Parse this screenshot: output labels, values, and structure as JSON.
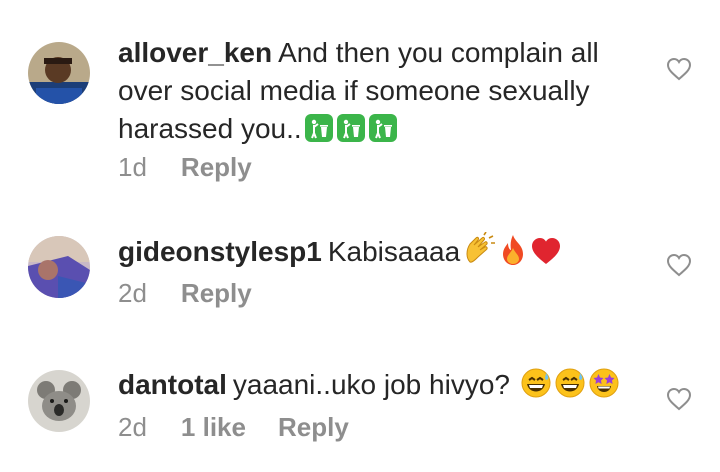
{
  "comments": [
    {
      "username": "allover_ken",
      "text": "And then you complain all over social media if someone sexually harassed you..",
      "emoji": [
        "litter-bin-icon",
        "litter-bin-icon",
        "litter-bin-icon"
      ],
      "time": "1d",
      "likes": "",
      "reply_label": "Reply"
    },
    {
      "username": "gideonstylesp1",
      "text": "Kabisaaaa",
      "emoji": [
        "clapping-hands-icon",
        "fire-icon",
        "red-heart-icon"
      ],
      "time": "2d",
      "likes": "",
      "reply_label": "Reply"
    },
    {
      "username": "dantotal",
      "text": "yaaani..uko job hivyo?",
      "emoji": [
        "grinning-sweat-face-icon",
        "grinning-sweat-face-icon",
        "star-struck-face-icon"
      ],
      "time": "2d",
      "likes": "1 like",
      "reply_label": "Reply"
    }
  ],
  "colors": {
    "text": "#262626",
    "meta": "#8e8e8e",
    "bin_green": "#3bb54a"
  }
}
